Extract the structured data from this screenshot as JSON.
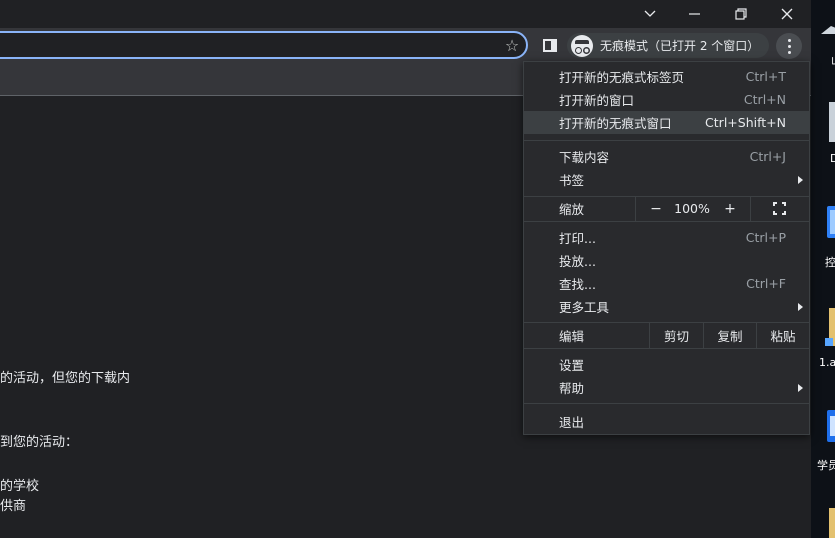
{
  "window": {
    "controls": [
      "chevron-down",
      "restore",
      "close"
    ]
  },
  "toolbar": {
    "incognito_label": "无痕模式（已打开 2 个窗口）"
  },
  "page": {
    "lines": [
      "的活动，但您的下载内",
      "到您的活动：",
      "的学校",
      "供商"
    ]
  },
  "menu": {
    "items": [
      {
        "label": "打开新的无痕式标签页",
        "shortcut": "Ctrl+T"
      },
      {
        "label": "打开新的窗口",
        "shortcut": "Ctrl+N"
      },
      {
        "label": "打开新的无痕式窗口",
        "shortcut": "Ctrl+Shift+N"
      },
      {
        "label": "下载内容",
        "shortcut": "Ctrl+J"
      },
      {
        "label": "书签",
        "shortcut": ""
      },
      {
        "label": "打印...",
        "shortcut": "Ctrl+P"
      },
      {
        "label": "投放...",
        "shortcut": ""
      },
      {
        "label": "查找...",
        "shortcut": "Ctrl+F"
      },
      {
        "label": "更多工具",
        "shortcut": ""
      },
      {
        "label": "设置",
        "shortcut": ""
      },
      {
        "label": "帮助",
        "shortcut": ""
      },
      {
        "label": "退出",
        "shortcut": ""
      }
    ],
    "zoom": {
      "label": "缩放",
      "minus": "−",
      "value": "100%",
      "plus": "+"
    },
    "edit": {
      "label": "编辑",
      "cut": "剪切",
      "copy": "复制",
      "paste": "粘贴"
    }
  },
  "desktop": {
    "labels": [
      "山",
      "D",
      "控",
      "1.a",
      "学员"
    ]
  },
  "colors": {
    "accent": "#8ab4f8",
    "menu_bg": "#292a2d",
    "highlight": "#3c4043"
  }
}
